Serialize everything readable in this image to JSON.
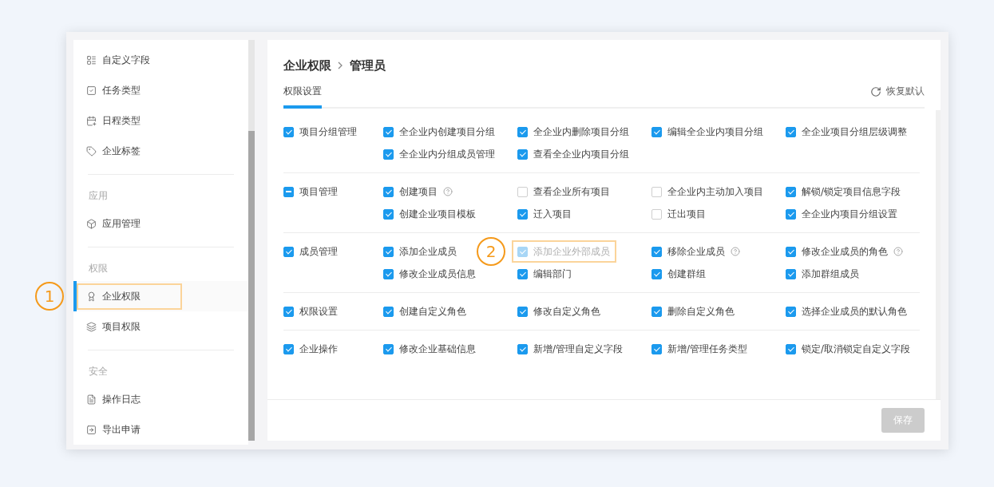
{
  "sidebar": {
    "sections": [
      {
        "items": [
          {
            "label": "自定义字段",
            "selected": false
          },
          {
            "label": "任务类型",
            "selected": false
          },
          {
            "label": "日程类型",
            "selected": false
          },
          {
            "label": "企业标签",
            "selected": false
          }
        ]
      },
      {
        "title": "应用",
        "items": [
          {
            "label": "应用管理",
            "selected": false
          }
        ]
      },
      {
        "title": "权限",
        "items": [
          {
            "label": "企业权限",
            "selected": true,
            "callout": "1"
          },
          {
            "label": "项目权限",
            "selected": false
          }
        ]
      },
      {
        "title": "安全",
        "items": [
          {
            "label": "操作日志",
            "selected": false
          },
          {
            "label": "导出申请",
            "selected": false
          }
        ]
      }
    ]
  },
  "breadcrumb": [
    "企业权限",
    "管理员"
  ],
  "tabs": [
    {
      "label": "权限设置",
      "selected": true
    }
  ],
  "restore_button": "恢复默认",
  "groups": [
    {
      "label": "项目分组管理",
      "checked": true,
      "items": [
        {
          "label": "全企业内创建项目分组",
          "checked": true
        },
        {
          "label": "全企业内删除项目分组",
          "checked": true
        },
        {
          "label": "编辑全企业内项目分组",
          "checked": true
        },
        {
          "label": "全企业项目分组层级调整",
          "checked": true
        },
        {
          "label": "全企业内分组成员管理",
          "checked": true
        },
        {
          "label": "查看全企业内项目分组",
          "checked": true
        }
      ]
    },
    {
      "label": "项目管理",
      "indeterminate": true,
      "items": [
        {
          "label": "创建项目",
          "checked": true,
          "help": true
        },
        {
          "label": "查看企业所有项目",
          "checked": false
        },
        {
          "label": "全企业内主动加入项目",
          "checked": false
        },
        {
          "label": "解锁/锁定项目信息字段",
          "checked": true
        },
        {
          "label": "创建企业项目模板",
          "checked": true
        },
        {
          "label": "迁入项目",
          "checked": true
        },
        {
          "label": "迁出项目",
          "checked": false
        },
        {
          "label": "全企业内项目分组设置",
          "checked": true
        }
      ]
    },
    {
      "label": "成员管理",
      "checked": true,
      "items": [
        {
          "label": "添加企业成员",
          "checked": true
        },
        {
          "label": "添加企业外部成员",
          "checked": true,
          "disabled": true,
          "callout": "2"
        },
        {
          "label": "移除企业成员",
          "checked": true,
          "help": true
        },
        {
          "label": "修改企业成员的角色",
          "checked": true,
          "help": true
        },
        {
          "label": "修改企业成员信息",
          "checked": true
        },
        {
          "label": "编辑部门",
          "checked": true
        },
        {
          "label": "创建群组",
          "checked": true
        },
        {
          "label": "添加群组成员",
          "checked": true
        }
      ]
    },
    {
      "label": "权限设置",
      "checked": true,
      "items": [
        {
          "label": "创建自定义角色",
          "checked": true
        },
        {
          "label": "修改自定义角色",
          "checked": true
        },
        {
          "label": "删除自定义角色",
          "checked": true
        },
        {
          "label": "选择企业成员的默认角色",
          "checked": true
        }
      ]
    },
    {
      "label": "企业操作",
      "checked": true,
      "items": [
        {
          "label": "修改企业基础信息",
          "checked": true
        },
        {
          "label": "新增/管理自定义字段",
          "checked": true
        },
        {
          "label": "新增/管理任务类型",
          "checked": true
        },
        {
          "label": "锁定/取消锁定自定义字段",
          "checked": true
        }
      ]
    }
  ],
  "save_button": {
    "label": "保存",
    "disabled": true
  }
}
